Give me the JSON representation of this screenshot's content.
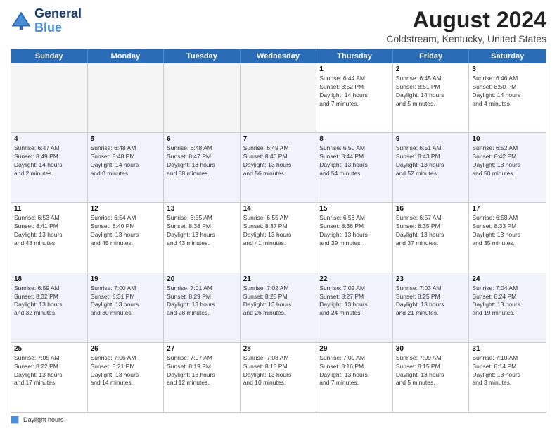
{
  "logo": {
    "line1": "General",
    "line2": "Blue"
  },
  "title": "August 2024",
  "subtitle": "Coldstream, Kentucky, United States",
  "days_of_week": [
    "Sunday",
    "Monday",
    "Tuesday",
    "Wednesday",
    "Thursday",
    "Friday",
    "Saturday"
  ],
  "legend_label": "Daylight hours",
  "weeks": [
    [
      {
        "day": "",
        "info": "",
        "empty": true
      },
      {
        "day": "",
        "info": "",
        "empty": true
      },
      {
        "day": "",
        "info": "",
        "empty": true
      },
      {
        "day": "",
        "info": "",
        "empty": true
      },
      {
        "day": "1",
        "info": "Sunrise: 6:44 AM\nSunset: 8:52 PM\nDaylight: 14 hours\nand 7 minutes.",
        "empty": false
      },
      {
        "day": "2",
        "info": "Sunrise: 6:45 AM\nSunset: 8:51 PM\nDaylight: 14 hours\nand 5 minutes.",
        "empty": false
      },
      {
        "day": "3",
        "info": "Sunrise: 6:46 AM\nSunset: 8:50 PM\nDaylight: 14 hours\nand 4 minutes.",
        "empty": false
      }
    ],
    [
      {
        "day": "4",
        "info": "Sunrise: 6:47 AM\nSunset: 8:49 PM\nDaylight: 14 hours\nand 2 minutes.",
        "empty": false
      },
      {
        "day": "5",
        "info": "Sunrise: 6:48 AM\nSunset: 8:48 PM\nDaylight: 14 hours\nand 0 minutes.",
        "empty": false
      },
      {
        "day": "6",
        "info": "Sunrise: 6:48 AM\nSunset: 8:47 PM\nDaylight: 13 hours\nand 58 minutes.",
        "empty": false
      },
      {
        "day": "7",
        "info": "Sunrise: 6:49 AM\nSunset: 8:46 PM\nDaylight: 13 hours\nand 56 minutes.",
        "empty": false
      },
      {
        "day": "8",
        "info": "Sunrise: 6:50 AM\nSunset: 8:44 PM\nDaylight: 13 hours\nand 54 minutes.",
        "empty": false
      },
      {
        "day": "9",
        "info": "Sunrise: 6:51 AM\nSunset: 8:43 PM\nDaylight: 13 hours\nand 52 minutes.",
        "empty": false
      },
      {
        "day": "10",
        "info": "Sunrise: 6:52 AM\nSunset: 8:42 PM\nDaylight: 13 hours\nand 50 minutes.",
        "empty": false
      }
    ],
    [
      {
        "day": "11",
        "info": "Sunrise: 6:53 AM\nSunset: 8:41 PM\nDaylight: 13 hours\nand 48 minutes.",
        "empty": false
      },
      {
        "day": "12",
        "info": "Sunrise: 6:54 AM\nSunset: 8:40 PM\nDaylight: 13 hours\nand 45 minutes.",
        "empty": false
      },
      {
        "day": "13",
        "info": "Sunrise: 6:55 AM\nSunset: 8:38 PM\nDaylight: 13 hours\nand 43 minutes.",
        "empty": false
      },
      {
        "day": "14",
        "info": "Sunrise: 6:55 AM\nSunset: 8:37 PM\nDaylight: 13 hours\nand 41 minutes.",
        "empty": false
      },
      {
        "day": "15",
        "info": "Sunrise: 6:56 AM\nSunset: 8:36 PM\nDaylight: 13 hours\nand 39 minutes.",
        "empty": false
      },
      {
        "day": "16",
        "info": "Sunrise: 6:57 AM\nSunset: 8:35 PM\nDaylight: 13 hours\nand 37 minutes.",
        "empty": false
      },
      {
        "day": "17",
        "info": "Sunrise: 6:58 AM\nSunset: 8:33 PM\nDaylight: 13 hours\nand 35 minutes.",
        "empty": false
      }
    ],
    [
      {
        "day": "18",
        "info": "Sunrise: 6:59 AM\nSunset: 8:32 PM\nDaylight: 13 hours\nand 32 minutes.",
        "empty": false
      },
      {
        "day": "19",
        "info": "Sunrise: 7:00 AM\nSunset: 8:31 PM\nDaylight: 13 hours\nand 30 minutes.",
        "empty": false
      },
      {
        "day": "20",
        "info": "Sunrise: 7:01 AM\nSunset: 8:29 PM\nDaylight: 13 hours\nand 28 minutes.",
        "empty": false
      },
      {
        "day": "21",
        "info": "Sunrise: 7:02 AM\nSunset: 8:28 PM\nDaylight: 13 hours\nand 26 minutes.",
        "empty": false
      },
      {
        "day": "22",
        "info": "Sunrise: 7:02 AM\nSunset: 8:27 PM\nDaylight: 13 hours\nand 24 minutes.",
        "empty": false
      },
      {
        "day": "23",
        "info": "Sunrise: 7:03 AM\nSunset: 8:25 PM\nDaylight: 13 hours\nand 21 minutes.",
        "empty": false
      },
      {
        "day": "24",
        "info": "Sunrise: 7:04 AM\nSunset: 8:24 PM\nDaylight: 13 hours\nand 19 minutes.",
        "empty": false
      }
    ],
    [
      {
        "day": "25",
        "info": "Sunrise: 7:05 AM\nSunset: 8:22 PM\nDaylight: 13 hours\nand 17 minutes.",
        "empty": false
      },
      {
        "day": "26",
        "info": "Sunrise: 7:06 AM\nSunset: 8:21 PM\nDaylight: 13 hours\nand 14 minutes.",
        "empty": false
      },
      {
        "day": "27",
        "info": "Sunrise: 7:07 AM\nSunset: 8:19 PM\nDaylight: 13 hours\nand 12 minutes.",
        "empty": false
      },
      {
        "day": "28",
        "info": "Sunrise: 7:08 AM\nSunset: 8:18 PM\nDaylight: 13 hours\nand 10 minutes.",
        "empty": false
      },
      {
        "day": "29",
        "info": "Sunrise: 7:09 AM\nSunset: 8:16 PM\nDaylight: 13 hours\nand 7 minutes.",
        "empty": false
      },
      {
        "day": "30",
        "info": "Sunrise: 7:09 AM\nSunset: 8:15 PM\nDaylight: 13 hours\nand 5 minutes.",
        "empty": false
      },
      {
        "day": "31",
        "info": "Sunrise: 7:10 AM\nSunset: 8:14 PM\nDaylight: 13 hours\nand 3 minutes.",
        "empty": false
      }
    ]
  ]
}
